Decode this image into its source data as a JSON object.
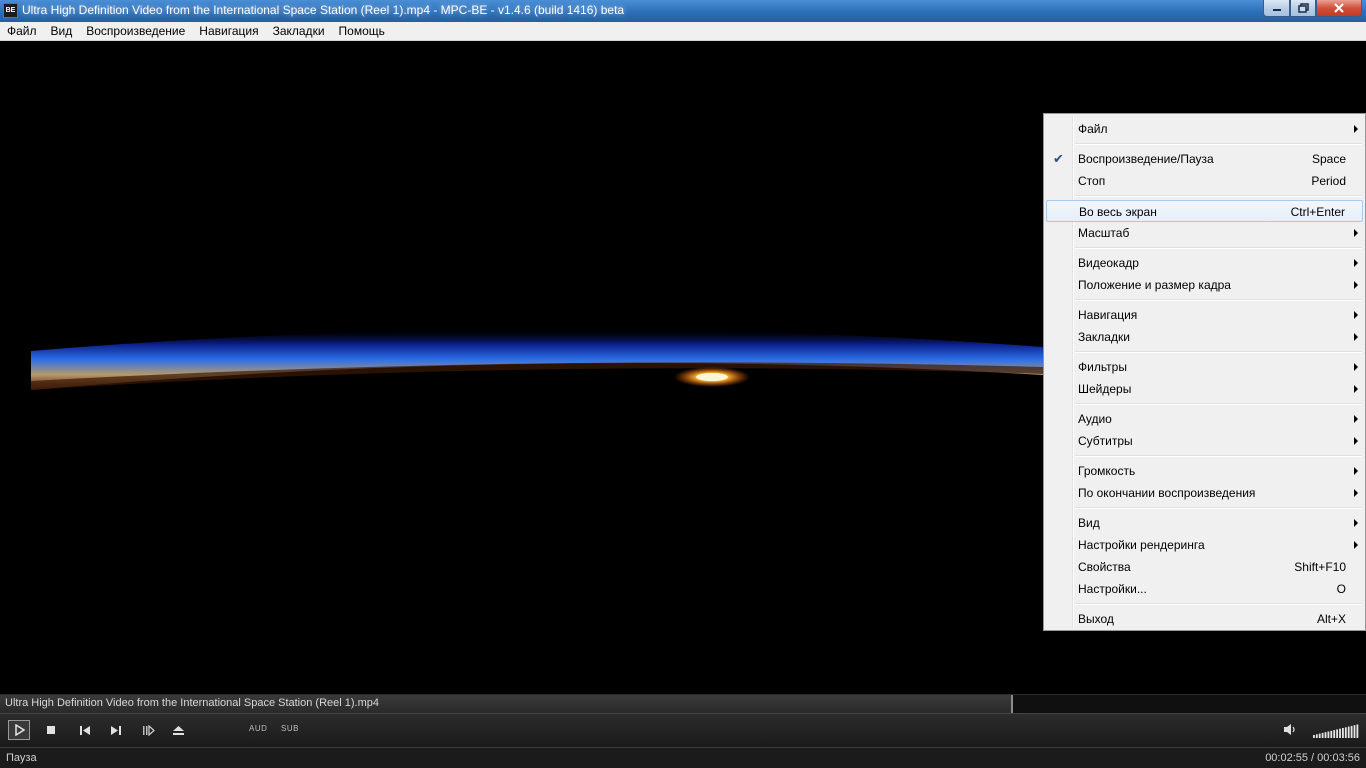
{
  "window": {
    "title": "Ultra High Definition Video from the International Space Station  (Reel 1).mp4 - MPC-BE - v1.4.6 (build 1416) beta",
    "icon": "mpc-be-app-icon",
    "buttons": {
      "minimize": "minimize-icon",
      "maximize": "restore-icon",
      "close": "close-icon"
    }
  },
  "menubar": [
    "Файл",
    "Вид",
    "Воспроизведение",
    "Навигация",
    "Закладки",
    "Помощь"
  ],
  "context_menu": {
    "items": [
      {
        "label": "Файл",
        "shortcut": "",
        "submenu": true
      },
      {
        "label": "Воспроизведение/Пауза",
        "shortcut": "Space",
        "submenu": false,
        "checked": true
      },
      {
        "label": "Стоп",
        "shortcut": "Period",
        "submenu": false
      },
      {
        "label": "Во весь экран",
        "shortcut": "Ctrl+Enter",
        "submenu": false,
        "highlighted": true
      },
      {
        "label": "Масштаб",
        "shortcut": "",
        "submenu": true
      },
      {
        "label": "Видеокадр",
        "shortcut": "",
        "submenu": true
      },
      {
        "label": "Положение и размер кадра",
        "shortcut": "",
        "submenu": true
      },
      {
        "label": "Навигация",
        "shortcut": "",
        "submenu": true
      },
      {
        "label": "Закладки",
        "shortcut": "",
        "submenu": true
      },
      {
        "label": "Фильтры",
        "shortcut": "",
        "submenu": true
      },
      {
        "label": "Шейдеры",
        "shortcut": "",
        "submenu": true
      },
      {
        "label": "Аудио",
        "shortcut": "",
        "submenu": true
      },
      {
        "label": "Субтитры",
        "shortcut": "",
        "submenu": true
      },
      {
        "label": "Громкость",
        "shortcut": "",
        "submenu": true
      },
      {
        "label": "По окончании воспроизведения",
        "shortcut": "",
        "submenu": true
      },
      {
        "label": "Вид",
        "shortcut": "",
        "submenu": true
      },
      {
        "label": "Настройки рендеринга",
        "shortcut": "",
        "submenu": true
      },
      {
        "label": "Свойства",
        "shortcut": "Shift+F10",
        "submenu": false
      },
      {
        "label": "Настройки...",
        "shortcut": "O",
        "submenu": false
      },
      {
        "label": "Выход",
        "shortcut": "Alt+X",
        "submenu": false
      }
    ]
  },
  "infobar": {
    "filename": "Ultra High Definition Video from the International Space Station  (Reel 1).mp4",
    "progress_fraction": 0.74
  },
  "controls": {
    "play": "play-icon",
    "stop": "stop-icon",
    "prev": "skip-back-icon",
    "next": "skip-forward-icon",
    "frame_step": "frame-step-icon",
    "eject": "eject-icon",
    "audio_label": "AUD",
    "subtitle_label": "SUB",
    "volume_icon": "speaker-icon",
    "volume_level": 1.0
  },
  "status": {
    "state": "Пауза",
    "time": "00:02:55 / 00:03:56"
  },
  "colors": {
    "titlebar": "#2c6fb8",
    "menu_background": "#f0f0f0",
    "menu_highlight_border": "#a8c8ec",
    "player_background": "#1b1b1b"
  }
}
